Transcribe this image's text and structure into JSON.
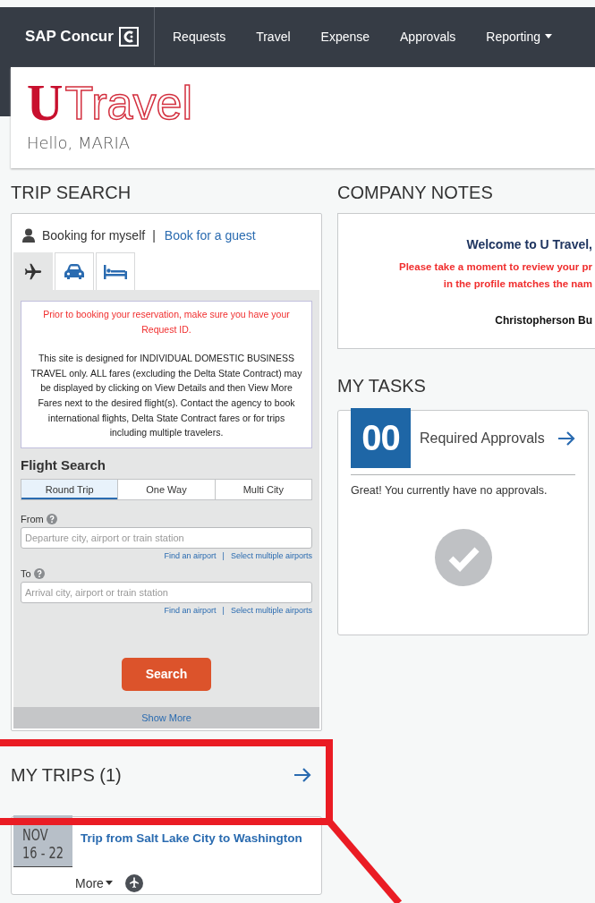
{
  "nav": {
    "brand": "SAP Concur",
    "items": [
      {
        "label": "Requests",
        "dropdown": false
      },
      {
        "label": "Travel",
        "dropdown": false
      },
      {
        "label": "Expense",
        "dropdown": false
      },
      {
        "label": "Approvals",
        "dropdown": false
      },
      {
        "label": "Reporting",
        "dropdown": true
      }
    ]
  },
  "header": {
    "logo_mark": "U",
    "logo_name": "Travel",
    "greeting": "Hello, MARIA"
  },
  "trip_search": {
    "title": "TRIP SEARCH",
    "booking_self": "Booking for myself",
    "separator": "|",
    "booking_guest": "Book for a guest",
    "tabs": [
      {
        "kind": "air",
        "selected": true
      },
      {
        "kind": "car",
        "selected": false
      },
      {
        "kind": "hotel",
        "selected": false
      }
    ],
    "notice_warning": "Prior to booking your reservation, make sure you have your Request ID.",
    "notice_text": "This site is designed for INDIVIDUAL DOMESTIC BUSINESS TRAVEL only. ALL fares (excluding the Delta State Contract) may be displayed by clicking on View Details and then View More Fares next to the desired flight(s). Contact the agency to book international flights, Delta State Contract fares or for trips including multiple travelers.",
    "form_title": "Flight Search",
    "trip_types": [
      {
        "label": "Round Trip",
        "selected": true
      },
      {
        "label": "One Way",
        "selected": false
      },
      {
        "label": "Multi City",
        "selected": false
      }
    ],
    "fields": [
      {
        "label": "From",
        "placeholder": "Departure city, airport or train station",
        "link_1": "Find an airport",
        "separator": "|",
        "link_2": "Select multiple airports"
      },
      {
        "label": "To",
        "placeholder": "Arrival city, airport or train station",
        "link_1": "Find an airport",
        "separator": "|",
        "link_2": "Select multiple airports"
      }
    ],
    "search_button": "Search",
    "show_more": "Show More"
  },
  "my_trips": {
    "title": "MY TRIPS (1)",
    "trips": [
      {
        "month": "NOV",
        "days": "16 - 22",
        "title": "Trip from Salt Lake City to Washington",
        "more": "More"
      }
    ]
  },
  "company_notes": {
    "title": "COMPANY NOTES",
    "welcome": "Welcome to U Travel,",
    "warning_lines": [
      "Please take a moment to review your pr",
      "in the profile matches the nam"
    ],
    "signature": "Christopherson Bu"
  },
  "my_tasks": {
    "title": "MY TASKS",
    "count": "00",
    "label": "Required Approvals",
    "message": "Great! You currently have no approvals."
  }
}
